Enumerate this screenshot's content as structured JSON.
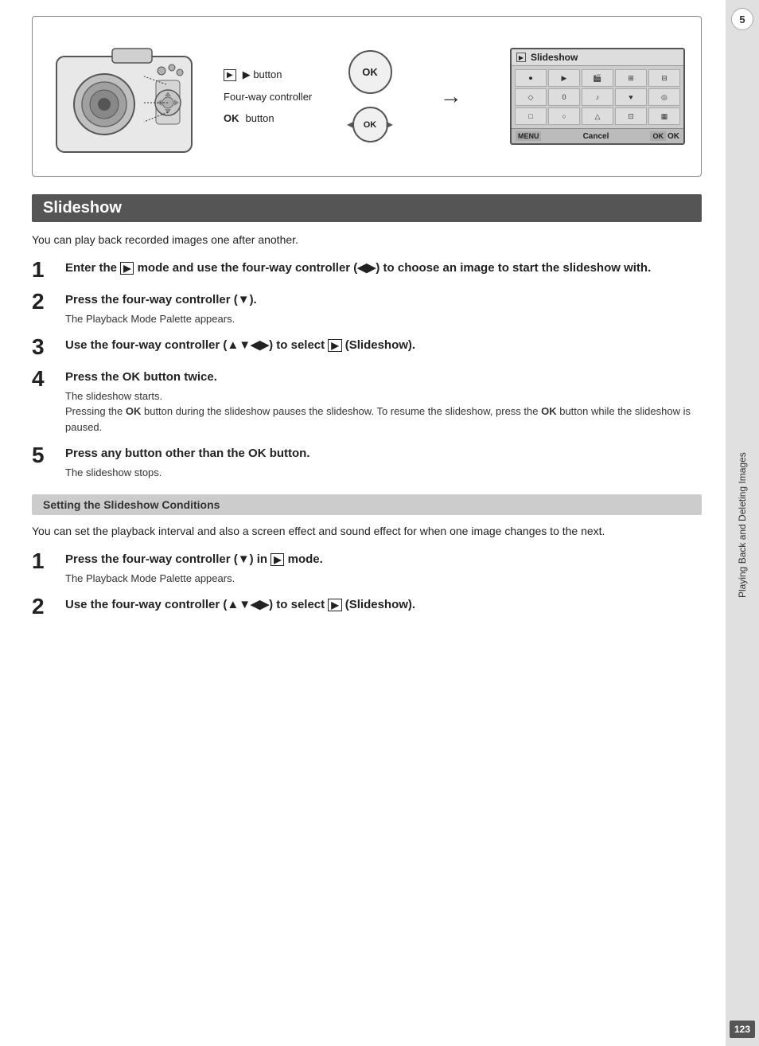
{
  "page": {
    "title": "Slideshow",
    "section_sub": "Setting the Slideshow Conditions",
    "intro": "You can play back recorded images one after another.",
    "intro2": "You can set the playback interval and also a screen effect and sound effect for when one image changes to the next.",
    "chapter_number": "5",
    "page_number": "123",
    "sidebar_text": "Playing Back and Deleting Images"
  },
  "diagram": {
    "play_button_label": "▶ button",
    "four_way_label": "Four-way controller",
    "ok_button_label": "button",
    "ok_button_bold": "OK",
    "ok_label": "OK",
    "screen_title": "Slideshow",
    "screen_cancel": "Cancel",
    "screen_ok": "OK",
    "screen_menu": "MENU",
    "screen_ok_label": "OK"
  },
  "steps": [
    {
      "number": "1",
      "title": "Enter the ▶ mode and use the four-way controller (◀▶) to choose an image to start the slideshow with.",
      "desc": ""
    },
    {
      "number": "2",
      "title": "Press the four-way controller (▼).",
      "desc": "The Playback Mode Palette appears."
    },
    {
      "number": "3",
      "title": "Use the four-way controller (▲▼◀▶) to select ▶ (Slideshow).",
      "desc": ""
    },
    {
      "number": "4",
      "title": "Press the OK button twice.",
      "title_ok": "OK",
      "desc": "The slideshow starts.\nPressing the OK button during the slideshow pauses the slideshow. To resume the slideshow, press the OK button while the slideshow is paused.",
      "desc_ok1": "OK",
      "desc_ok2": "OK"
    },
    {
      "number": "5",
      "title": "Press any button other than the OK button.",
      "title_ok": "OK",
      "desc": "The slideshow stops."
    }
  ],
  "steps2": [
    {
      "number": "1",
      "title": "Press the four-way controller (▼) in ▶ mode.",
      "desc": "The Playback Mode Palette appears."
    },
    {
      "number": "2",
      "title": "Use the four-way controller (▲▼◀▶) to select ▶ (Slideshow).",
      "desc": ""
    }
  ]
}
